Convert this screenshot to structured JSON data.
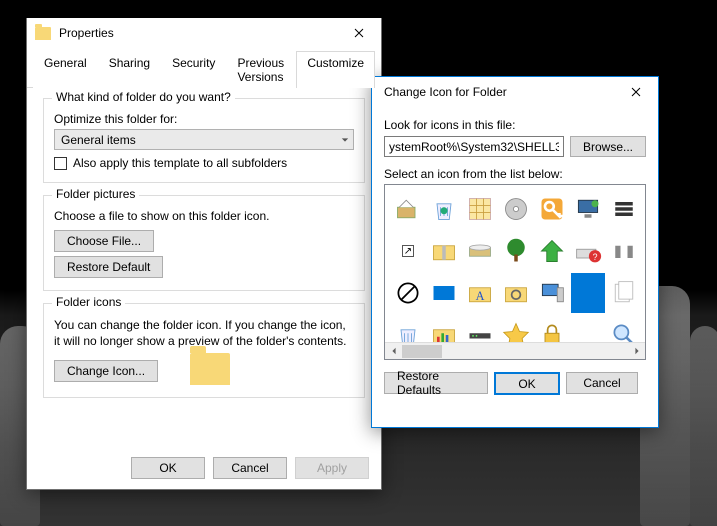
{
  "properties": {
    "title": "Properties",
    "tabs": {
      "general": "General",
      "sharing": "Sharing",
      "security": "Security",
      "previous": "Previous Versions",
      "customize": "Customize"
    },
    "kind": {
      "legend": "What kind of folder do you want?",
      "optimize_label": "Optimize this folder for:",
      "dropdown_value": "General items",
      "subfolders_label": "Also apply this template to all subfolders"
    },
    "pictures": {
      "legend": "Folder pictures",
      "desc": "Choose a file to show on this folder icon.",
      "choose": "Choose File...",
      "restore": "Restore Default"
    },
    "icons": {
      "legend": "Folder icons",
      "desc": "You can change the folder icon. If you change the icon, it will no longer show a preview of the folder's contents.",
      "change": "Change Icon..."
    },
    "footer": {
      "ok": "OK",
      "cancel": "Cancel",
      "apply": "Apply"
    }
  },
  "changeicon": {
    "title": "Change Icon for   Folder",
    "look_label": "Look for icons in this file:",
    "path_value": "ystemRoot%\\System32\\SHELL32.dll",
    "browse": "Browse...",
    "select_label": "Select an icon from the list below:",
    "footer": {
      "restore": "Restore Defaults",
      "ok": "OK",
      "cancel": "Cancel"
    },
    "icons": [
      "install-icon",
      "recycle-bin-icon",
      "grid-icon",
      "disc-icon",
      "key-icon",
      "monitor-icon",
      "panel-icon",
      "shortcut-overlay-icon",
      "zip-folder-icon",
      "drive-icon",
      "tree-icon",
      "up-arrow-icon",
      "drive-help-icon",
      "unknown-icon",
      "block-icon",
      "desktop-icon",
      "font-folder-icon",
      "settings-folder-icon",
      "computer-icon",
      "blank-selected-icon",
      "documents-stack-icon",
      "recycle-empty-icon",
      "chart-icon",
      "bar-icon",
      "star-icon",
      "lock-icon",
      "blank-icon",
      "search-icon"
    ]
  }
}
